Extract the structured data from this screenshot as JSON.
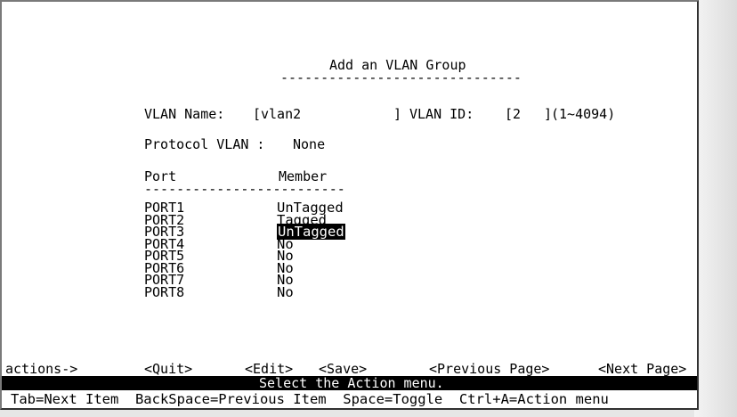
{
  "screen": {
    "title": "Add an VLAN Group",
    "title_rule": "------------------------------"
  },
  "form": {
    "vlan_name_label": "VLAN Name:",
    "vlan_name_open": "[",
    "vlan_name_value": "vlan2",
    "vlan_name_close": "]",
    "vlan_id_label": "VLAN ID:",
    "vlan_id_open": "[",
    "vlan_id_value": "2",
    "vlan_id_close": "]",
    "vlan_id_range": "(1~4094)",
    "protocol_label": "Protocol VLAN :",
    "protocol_value": "None"
  },
  "table": {
    "header_port": "Port",
    "header_member": "Member",
    "header_rule": "-------------------------",
    "rows": [
      {
        "port": "PORT1",
        "member": "UnTagged"
      },
      {
        "port": "PORT2",
        "member": "Tagged"
      },
      {
        "port": "PORT3",
        "member": "UnTagged"
      },
      {
        "port": "PORT4",
        "member": "No"
      },
      {
        "port": "PORT5",
        "member": "No"
      },
      {
        "port": "PORT6",
        "member": "No"
      },
      {
        "port": "PORT7",
        "member": "No"
      },
      {
        "port": "PORT8",
        "member": "No"
      }
    ],
    "selected_member_row": "PORT3"
  },
  "actions": {
    "label": "actions->",
    "quit": "<Quit>",
    "edit": "<Edit>",
    "save": "<Save>",
    "previous_page": "<Previous Page>",
    "next_page": "<Next Page>"
  },
  "status": {
    "message": "Select the Action menu."
  },
  "help": {
    "text": "Tab=Next Item  BackSpace=Previous Item  Space=Toggle  Ctrl+A=Action menu"
  }
}
